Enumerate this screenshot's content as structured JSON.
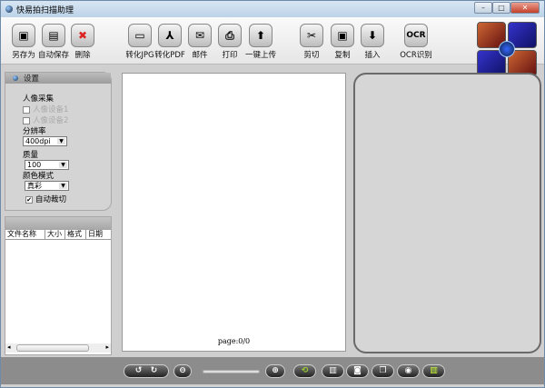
{
  "window": {
    "title": "快易拍扫描助理",
    "min": "–",
    "max": "□",
    "close": "✕"
  },
  "toolbar": [
    {
      "label": "另存为",
      "icon": "save-as-icon",
      "glyph": "▣"
    },
    {
      "label": "自动保存",
      "icon": "auto-save-icon",
      "glyph": "▤"
    },
    {
      "label": "删除",
      "icon": "delete-icon",
      "glyph": "✖"
    },
    {
      "label": "转化JPG",
      "icon": "jpg-icon",
      "glyph": "▭"
    },
    {
      "label": "转化PDF",
      "icon": "pdf-icon",
      "glyph": "⅄"
    },
    {
      "label": "邮件",
      "icon": "mail-icon",
      "glyph": "✉"
    },
    {
      "label": "打印",
      "icon": "print-icon",
      "glyph": "⎙"
    },
    {
      "label": "一键上传",
      "icon": "upload-icon",
      "glyph": "⬆"
    },
    {
      "label": "剪切",
      "icon": "scissors-icon",
      "glyph": "✂"
    },
    {
      "label": "复制",
      "icon": "copy-icon",
      "glyph": "▣"
    },
    {
      "label": "插入",
      "icon": "insert-icon",
      "glyph": "⬇"
    },
    {
      "label": "OCR识别",
      "icon": "ocr-icon",
      "glyph": "OCR"
    }
  ],
  "settings": {
    "title": "设置",
    "capture_label": "人像采集",
    "device1": "人像设备1",
    "device2": "人像设备2",
    "resolution_label": "分辨率",
    "resolution": "400dpi",
    "quality_label": "质量",
    "quality": "100",
    "color_label": "颜色模式",
    "color": "真彩",
    "autocrop_label": "自动裁切",
    "autocrop_checked": true
  },
  "files": {
    "columns": [
      "文件名称",
      "大小",
      "格式",
      "日期"
    ]
  },
  "document": {
    "page": "page:0/0"
  },
  "colors": {
    "accent": "#1e5fae"
  }
}
